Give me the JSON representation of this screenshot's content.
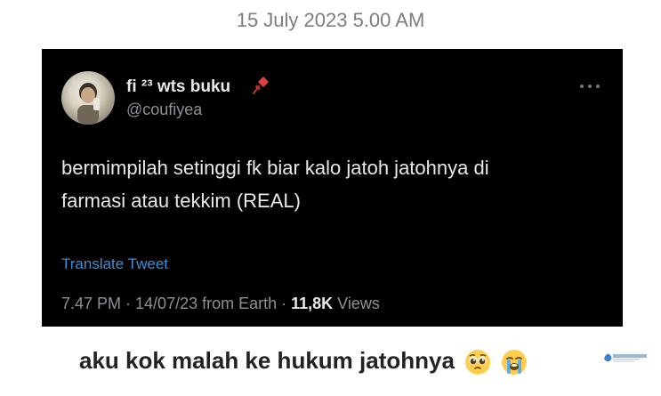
{
  "date_header": "15 July 2023 5.00 AM",
  "tweet": {
    "display_name": "fi ²³ wts buku",
    "handle": "@coufiyea",
    "text_line1": "bermimpilah setinggi fk biar kalo jatoh jatohnya di",
    "text_line2": "farmasi atau tekkim (REAL)",
    "translate_label": "Translate Tweet",
    "meta_prefix": "7.47 PM · 14/07/23 from Earth · ",
    "views_count": "11,8K",
    "views_label": " Views",
    "pin_icon": "pushpin-icon",
    "more_icon": "more-options-icon"
  },
  "caption": {
    "text": "aku kok malah ke hukum jatohnya",
    "emojis": [
      "pleading-face-icon",
      "loudly-crying-face-icon"
    ]
  },
  "colors": {
    "card_bg": "#000000",
    "link": "#3b8fd9",
    "muted": "#8b9298"
  }
}
